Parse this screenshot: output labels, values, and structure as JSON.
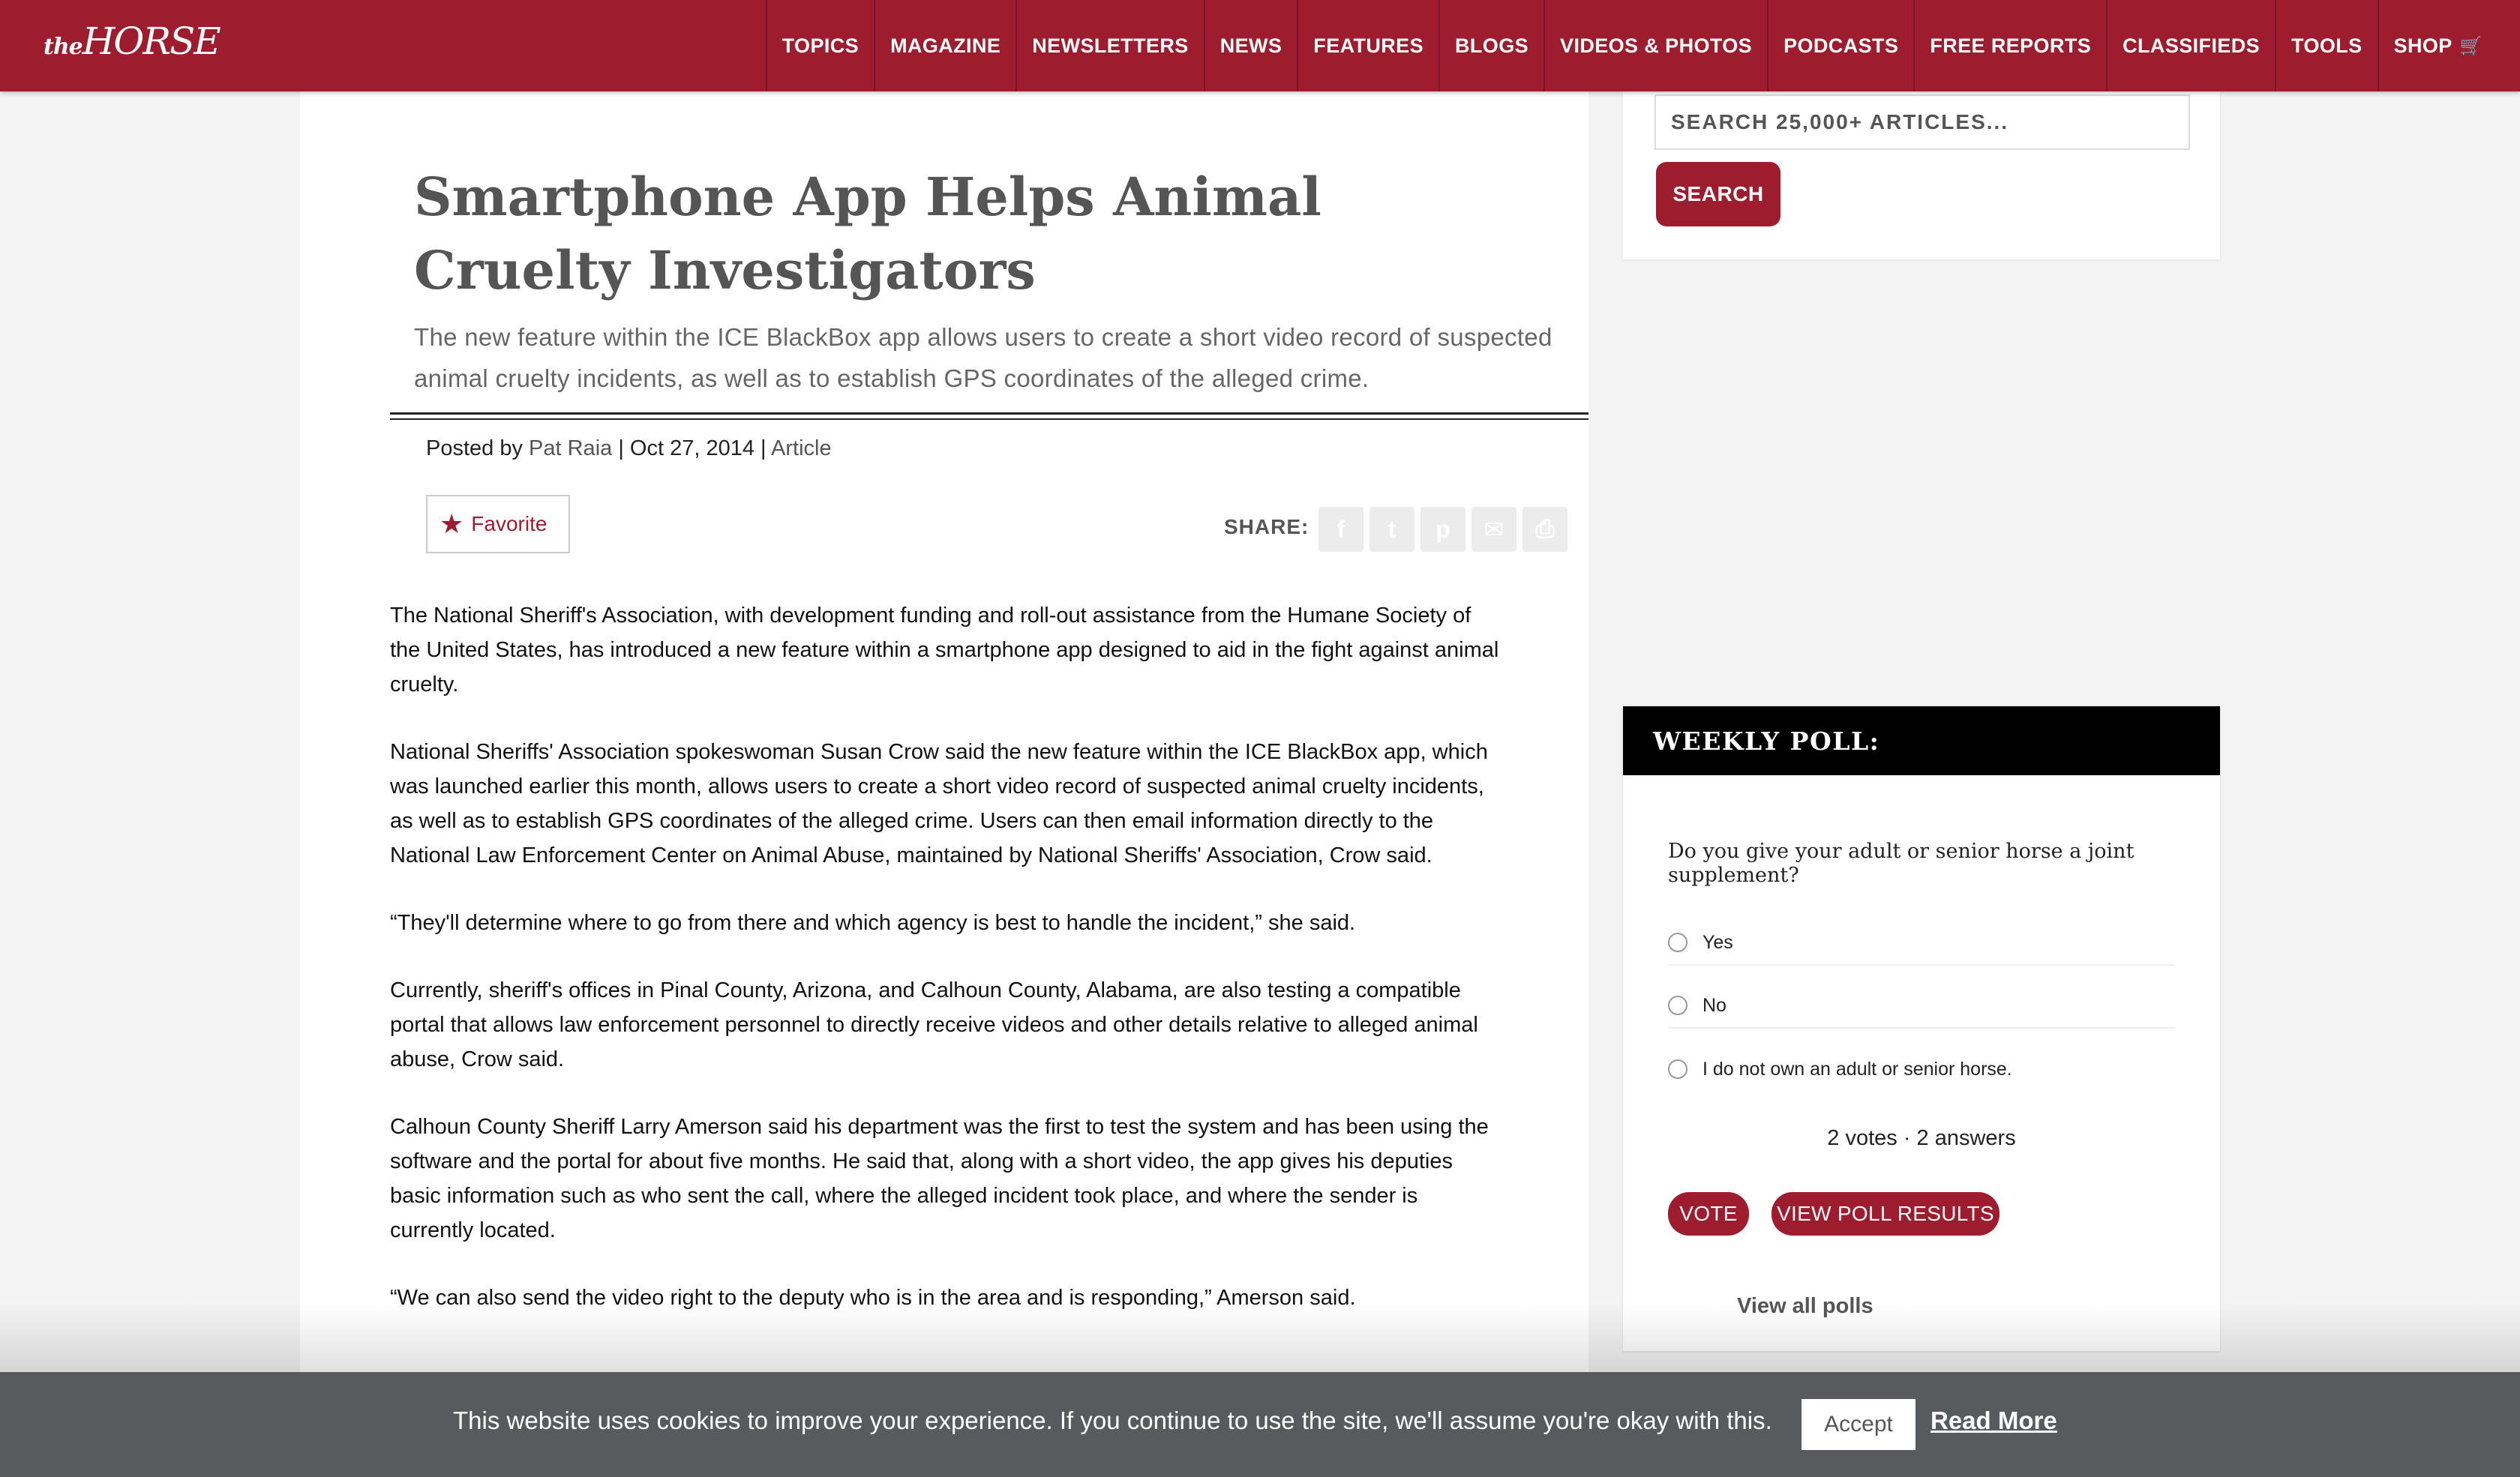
{
  "header": {
    "logo_the": "the",
    "logo_horse": "HORSE",
    "nav": [
      {
        "label": "TOPICS"
      },
      {
        "label": "MAGAZINE"
      },
      {
        "label": "NEWSLETTERS"
      },
      {
        "label": "NEWS"
      },
      {
        "label": "FEATURES"
      },
      {
        "label": "BLOGS"
      },
      {
        "label": "VIDEOS & PHOTOS"
      },
      {
        "label": "PODCASTS"
      },
      {
        "label": "FREE REPORTS"
      },
      {
        "label": "CLASSIFIEDS"
      },
      {
        "label": "TOOLS"
      },
      {
        "label": "SHOP"
      }
    ],
    "cart_icon": "🛒"
  },
  "article": {
    "title": "Smartphone App Helps Animal Cruelty Investigators",
    "subtitle": "The new feature within the ICE BlackBox app allows users to create a short video record of suspected animal cruelty incidents, as well as to establish GPS coordinates of the alleged crime.",
    "meta": {
      "posted_by_label": "Posted by ",
      "author": "Pat Raia",
      "sep1": " | ",
      "date": "Oct 27, 2014",
      "sep2": " | ",
      "category": "Article"
    },
    "favorite_label": "Favorite",
    "favorite_icon": "★",
    "share_label": "SHARE:",
    "share_icons": [
      "facebook-icon",
      "twitter-icon",
      "pinterest-icon",
      "email-icon",
      "print-icon"
    ],
    "share_glyphs": [
      "f",
      "t",
      "p",
      "✉",
      "⎙"
    ],
    "paragraphs": [
      "The National Sheriff's Association, with development funding and roll-out assistance from the Humane Society of the United States, has introduced a new feature within a smartphone app designed to aid in the fight against animal cruelty.",
      "National Sheriffs' Association spokeswoman Susan Crow said the new feature within the ICE BlackBox app, which was launched earlier this month, allows users to create a short video record of suspected animal cruelty incidents, as well as to establish GPS coordinates of the alleged crime. Users can then email information directly to the National Law Enforcement Center on Animal Abuse, maintained by National Sheriffs' Association, Crow said.",
      "“They'll determine where to go from there and which agency is best to handle the incident,” she said.",
      "Currently, sheriff's offices in Pinal County, Arizona, and Calhoun County, Alabama, are also testing a compatible portal that allows law enforcement personnel to directly receive videos and other details relative to alleged animal abuse, Crow said.",
      "Calhoun County Sheriff Larry Amerson said his department was the first to test the system and has been using the software and the portal for about five months. He said that, along with a short video, the app gives his deputies basic information such as who sent the call, where the alleged incident took place, and where the sender is currently located.",
      "“We can also send the video right to the deputy who is in the area and is responding,” Amerson said."
    ]
  },
  "sidebar": {
    "search": {
      "placeholder": "SEARCH 25,000+ ARTICLES...",
      "button_label": "SEARCH"
    },
    "poll": {
      "heading": "WEEKLY POLL:",
      "question": "Do you give your adult or senior horse a joint supplement?",
      "options": [
        {
          "label": "Yes"
        },
        {
          "label": "No"
        },
        {
          "label": "I do not own an adult or senior horse."
        }
      ],
      "votes_text": "2 votes · 2 answers",
      "vote_button": "VOTE",
      "results_button": "VIEW POLL RESULTS",
      "all_polls_link": "View all polls"
    }
  },
  "cookie_bar": {
    "message": "This website uses cookies to improve your experience. If you continue to use the site, we'll assume you're okay with this.",
    "accept_label": "Accept",
    "read_more_label": "Read More"
  },
  "colors": {
    "brand": "#9d1c2e",
    "cookie_bar": "#595a5d",
    "poll_header": "#000000"
  }
}
